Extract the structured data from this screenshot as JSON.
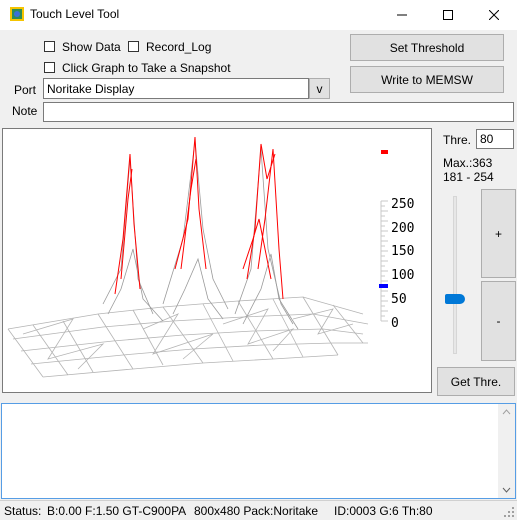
{
  "window": {
    "title": "Touch Level Tool",
    "controls": [
      "minimize",
      "maximize",
      "close"
    ]
  },
  "options": {
    "show_data_label": "Show Data",
    "record_log_label": "Record_Log",
    "snapshot_label": "Click Graph to Take a Snapshot",
    "show_data_checked": false,
    "record_log_checked": false,
    "snapshot_checked": false
  },
  "buttons": {
    "set_threshold": "Set Threshold",
    "write_memsw": "Write to MEMSW",
    "plus": "+",
    "minus": "-",
    "get_thre": "Get Thre."
  },
  "port": {
    "label": "Port",
    "value": "Noritake Display",
    "dropdown_glyph": "v"
  },
  "note": {
    "label": "Note",
    "value": ""
  },
  "threshold": {
    "label": "Thre.",
    "value": "80",
    "max_text": "Max.:363",
    "range_text": "181 - 254",
    "slider_fraction": 0.34
  },
  "graph": {
    "scale_labels": [
      "250",
      "200",
      "150",
      "100",
      "50",
      "0"
    ],
    "threshold_color": "#0000ff",
    "peak_color": "#ff0000",
    "mesh_color": "#b0b0b0"
  },
  "status": {
    "label": "Status:",
    "info": "B:0.00 F:1.50 GT-C900PA",
    "display": "800x480 Pack:Noritake",
    "ids": "ID:0003 G:6 Th:80"
  }
}
